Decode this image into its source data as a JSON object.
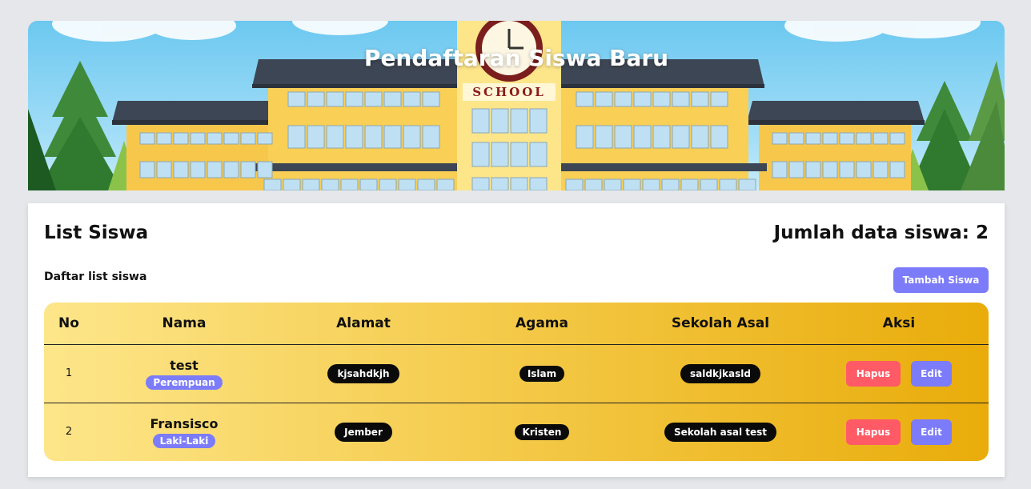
{
  "banner": {
    "title": "Pendaftaran Siswa Baru",
    "sign_text": "SCHOOL"
  },
  "card": {
    "title": "List Siswa",
    "count_label": "Jumlah data siswa: 2",
    "subtitle": "Daftar list siswa",
    "add_button": "Tambah Siswa"
  },
  "table": {
    "headers": [
      "No",
      "Nama",
      "Alamat",
      "Agama",
      "Sekolah Asal",
      "Aksi"
    ],
    "rows": [
      {
        "no": "1",
        "nama": "test",
        "gender": "Perempuan",
        "alamat": "kjsahdkjh",
        "agama": "Islam",
        "sekolah": "saldkjkasld"
      },
      {
        "no": "2",
        "nama": "Fransisco",
        "gender": "Laki-Laki",
        "alamat": "Jember",
        "agama": "Kristen",
        "sekolah": "Sekolah asal test"
      }
    ],
    "delete_label": "Hapus",
    "edit_label": "Edit"
  },
  "colors": {
    "accent": "#7c7cfa",
    "danger": "#ff5a66",
    "table_gradient_start": "#fde68a",
    "table_gradient_end": "#e9ac0a"
  }
}
